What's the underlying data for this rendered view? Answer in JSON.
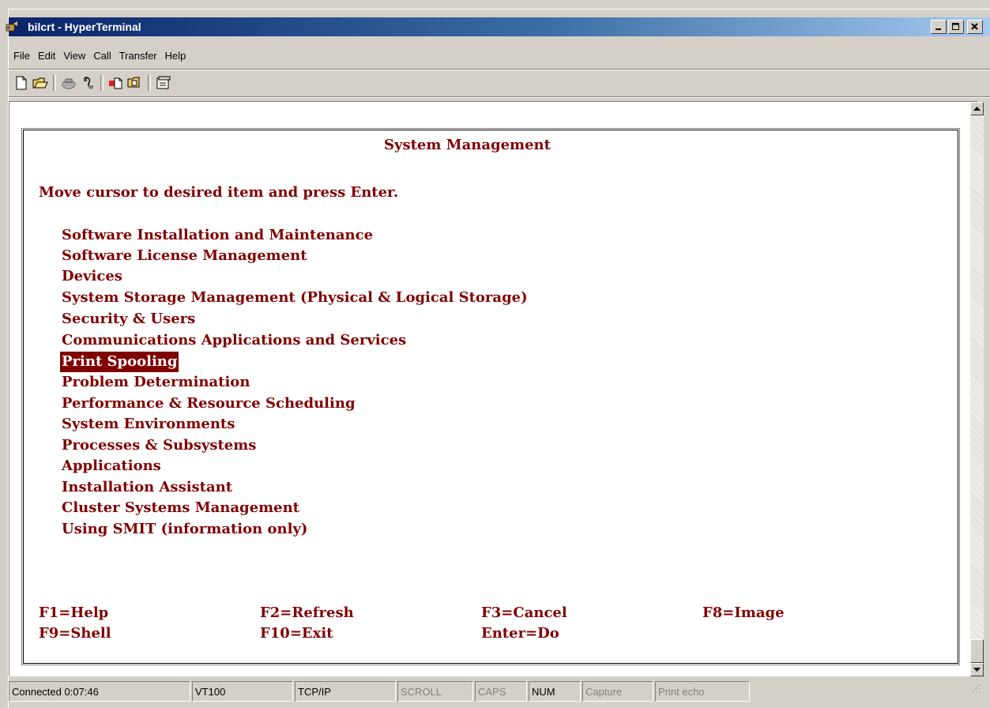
{
  "window": {
    "title": "bilcrt - HyperTerminal"
  },
  "menu": [
    "File",
    "Edit",
    "View",
    "Call",
    "Transfer",
    "Help"
  ],
  "toolbar": [
    "new-connection-icon",
    "open-icon",
    "connect-icon",
    "disconnect-icon",
    "send-icon",
    "receive-icon",
    "properties-icon"
  ],
  "screen": {
    "heading": "System Management",
    "instruction": "Move cursor to desired item and press Enter.",
    "items": [
      "Software Installation and Maintenance",
      "Software License Management",
      "Devices",
      "System Storage Management (Physical & Logical Storage)",
      "Security & Users",
      "Communications Applications and Services",
      "Print Spooling",
      "Problem Determination",
      "Performance & Resource Scheduling",
      "System Environments",
      "Processes & Subsystems",
      "Applications",
      "Installation Assistant",
      "Cluster Systems Management",
      "Using SMIT (information only)"
    ],
    "selected_item": "Print Spooling",
    "fkeys": {
      "f1": "F1=Help",
      "f2": "F2=Refresh",
      "f3": "F3=Cancel",
      "f8": "F8=Image",
      "f9": "F9=Shell",
      "f10": "F10=Exit",
      "enter": "Enter=Do"
    }
  },
  "status": {
    "connected": "Connected 0:07:46",
    "emulation": "VT100",
    "protocol": "TCP/IP",
    "scroll": "SCROLL",
    "caps": "CAPS",
    "num": "NUM",
    "capture": "Capture",
    "print_echo": "Print echo"
  }
}
